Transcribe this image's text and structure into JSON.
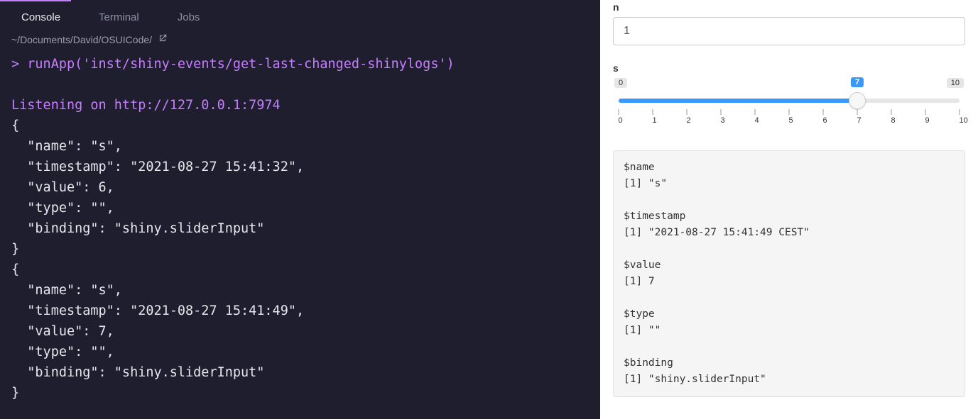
{
  "left": {
    "tabs": [
      "Console",
      "Terminal",
      "Jobs"
    ],
    "active_tab": 0,
    "path": "~/Documents/David/OSUICode/",
    "prompt": ">",
    "command": "runApp('inst/shiny-events/get-last-changed-shinylogs')",
    "listening": "Listening on http://127.0.0.1:7974",
    "json_output": "{\n  \"name\": \"s\",\n  \"timestamp\": \"2021-08-27 15:41:32\",\n  \"value\": 6,\n  \"type\": \"\",\n  \"binding\": \"shiny.sliderInput\"\n}\n{\n  \"name\": \"s\",\n  \"timestamp\": \"2021-08-27 15:41:49\",\n  \"value\": 7,\n  \"type\": \"\",\n  \"binding\": \"shiny.sliderInput\"\n}"
  },
  "right": {
    "n_label": "n",
    "n_value": "1",
    "s_label": "s",
    "s_min": "0",
    "s_max": "10",
    "s_value": "7",
    "s_percent": 70,
    "ticks": [
      "0",
      "1",
      "2",
      "3",
      "4",
      "5",
      "6",
      "7",
      "8",
      "9",
      "10"
    ],
    "output": "$name\n[1] \"s\"\n\n$timestamp\n[1] \"2021-08-27 15:41:49 CEST\"\n\n$value\n[1] 7\n\n$type\n[1] \"\"\n\n$binding\n[1] \"shiny.sliderInput\""
  }
}
